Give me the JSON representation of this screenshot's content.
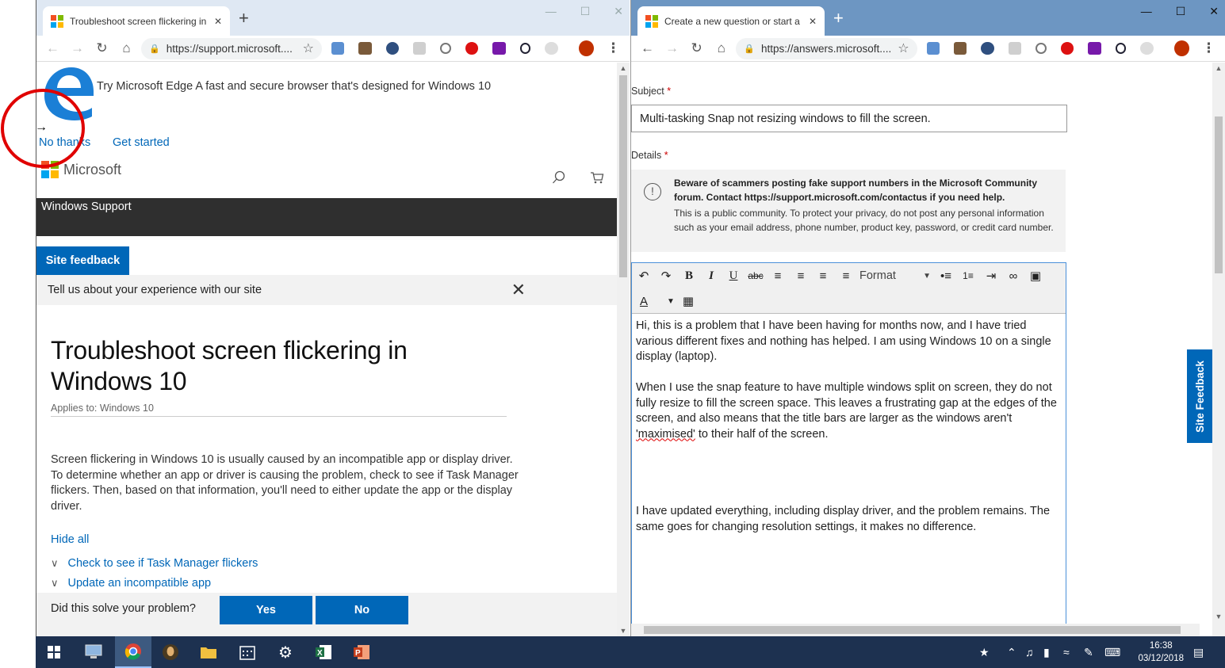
{
  "left_window": {
    "tab_title": "Troubleshoot screen flickering in",
    "tab_close": "✕",
    "new_tab": "+",
    "url": "https://support.microsoft....",
    "edge_promo": "Try Microsoft Edge A fast and secure browser that's designed for Windows 10",
    "no_thanks": "No thanks",
    "get_started": "Get started",
    "brand": "Microsoft",
    "nav_bar_title": "Windows Support",
    "site_feedback": "Site feedback",
    "survey_prompt": "Tell us about your experience with our site",
    "survey_close": "✕",
    "article_title": "Troubleshoot screen flickering in Windows 10",
    "applies_to": "Applies to: Windows 10",
    "intro": "Screen flickering in Windows 10 is usually caused by an incompatible app or display driver. To determine whether an app or driver is causing the problem, check to see if Task Manager flickers. Then, based on that information, you'll need to either update the app or the display driver.",
    "hide_all": "Hide all",
    "accordion": [
      "Check to see if Task Manager flickers",
      "Update an incompatible app"
    ],
    "solve_question": "Did this solve your problem?",
    "yes": "Yes",
    "no": "No"
  },
  "right_window": {
    "tab_title": "Create a new question or start a",
    "tab_close": "✕",
    "new_tab": "+",
    "url": "https://answers.microsoft....",
    "subject_label": "Subject",
    "required_mark": "*",
    "subject_value": "Multi-tasking Snap not resizing windows to fill the screen.",
    "details_label": "Details",
    "warning_bold": "Beware of scammers posting fake support numbers in the Microsoft Community forum. Contact https://support.microsoft.com/contactus if you need help.",
    "warning_text": "This is a public community. To protect your privacy, do not post any personal information such as your email address, phone number, product key, password, or credit card number.",
    "format_label": "Format",
    "body_p1": "Hi, this is a problem that I have been having for months now, and I have tried various different fixes and nothing has helped. I am using Windows 10 on a single display (laptop).",
    "body_p2a": "When I use the snap feature to have multiple windows split on screen, they do not fully resize to fill the screen space. This leaves a frustrating gap at the edges of the screen, and also means that the title bars are larger as the windows aren't ",
    "body_p2_misspelled": "'maximised'",
    "body_p2b": " to their half of the screen.",
    "body_p3": "I have updated everything, including display driver, and the problem remains. The same goes for changing resolution settings, it makes no difference.",
    "site_feedback_side": "Site Feedback"
  },
  "taskbar": {
    "time": "16:38",
    "date": "03/12/2018"
  },
  "colors": {
    "accent_blue": "#0067b8",
    "dark_header": "#2f2f2f",
    "taskbar": "#1d3150",
    "annotation_red": "#e00000"
  }
}
